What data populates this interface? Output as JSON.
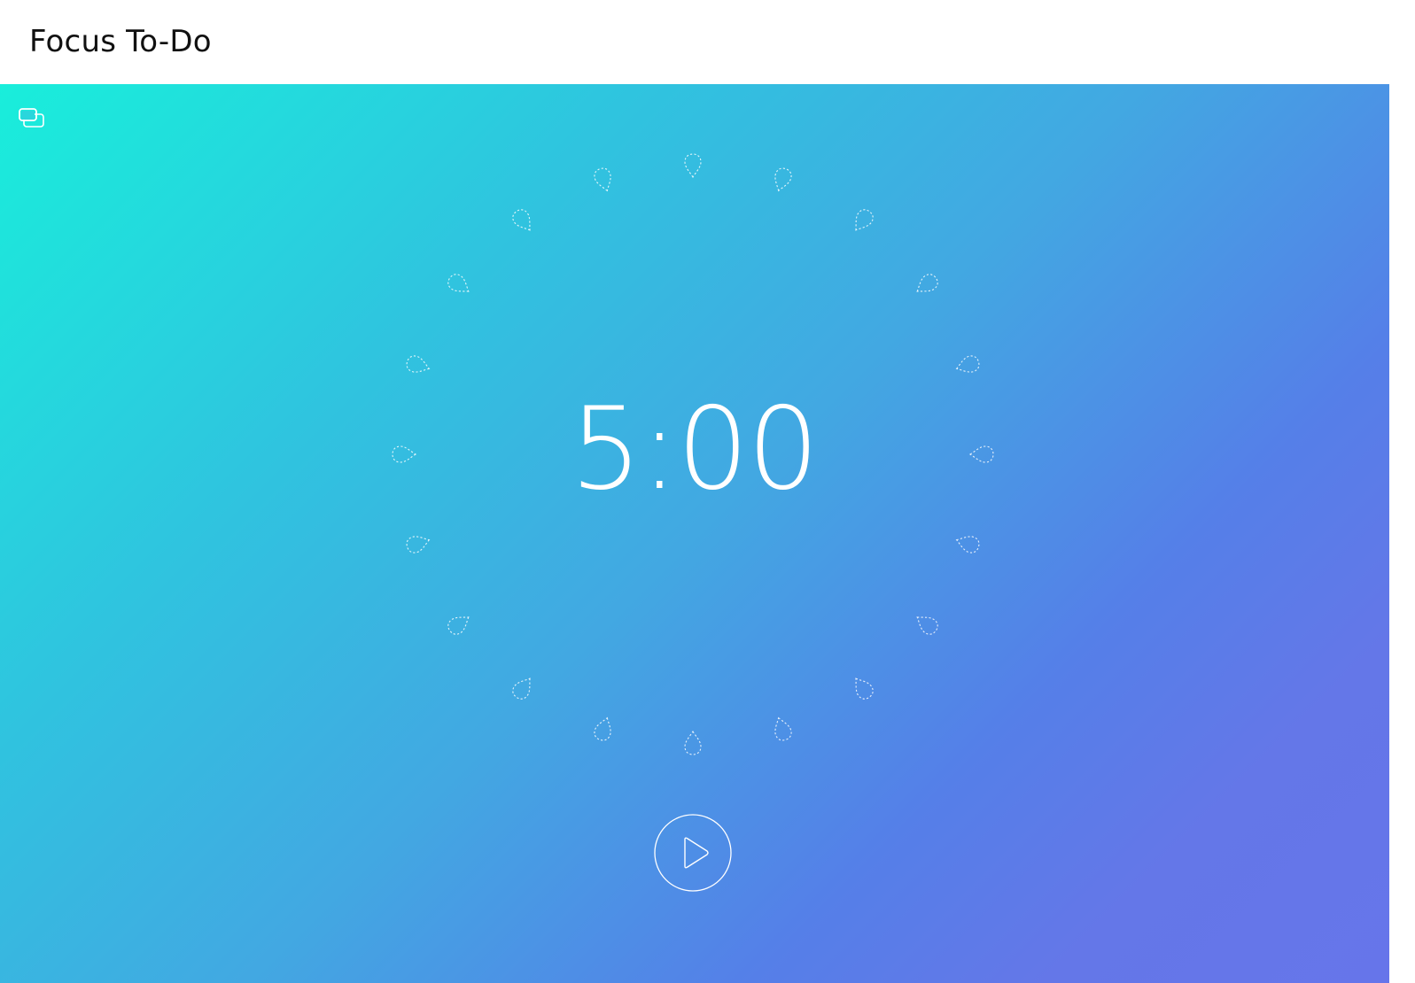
{
  "app": {
    "title": "Focus To-Do"
  },
  "timer": {
    "display": "5:00"
  },
  "icons": {
    "mini_mode": "mini-window-icon",
    "play": "play-icon",
    "drop": "water-drop-icon"
  },
  "pomodoro_ring": {
    "slot_count": 20,
    "filled_count": 0
  },
  "colors": {
    "gradient_start": "#19eedb",
    "gradient_end": "#6675ea",
    "foreground": "#ffffff",
    "titlebar": "#ffffff"
  }
}
